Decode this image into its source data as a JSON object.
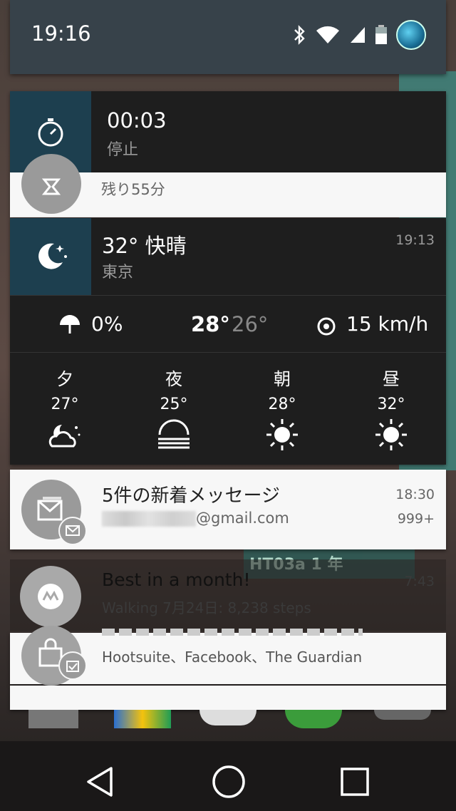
{
  "status_bar": {
    "time": "19:16"
  },
  "stopwatch": {
    "elapsed": "00:03",
    "state": "停止"
  },
  "timer_card": {
    "remaining": "残り55分"
  },
  "weather": {
    "temp_condition": "32° 快晴",
    "city": "東京",
    "updated": "19:13",
    "precip": "0%",
    "high": "28°",
    "low": "26°",
    "wind": "15 km/h",
    "forecast": [
      {
        "label": "夕",
        "temp": "27°",
        "icon": "night-partly-cloudy-icon"
      },
      {
        "label": "夜",
        "temp": "25°",
        "icon": "haze-icon"
      },
      {
        "label": "朝",
        "temp": "28°",
        "icon": "sun-icon"
      },
      {
        "label": "昼",
        "temp": "32°",
        "icon": "sun-icon"
      }
    ]
  },
  "gmail": {
    "title": "5件の新着メッセージ",
    "account": "@gmail.com",
    "time": "18:30",
    "count": "999+"
  },
  "fit": {
    "title": "Best in a month!",
    "detail": "Walking 7月24日: 8,238 steps",
    "time": "7:43"
  },
  "bg_widget": {
    "text": "HT03a 1 年"
  },
  "updates": {
    "apps": "Hootsuite、Facebook、The Guardian"
  },
  "colors": {
    "accent": "#1d3f4f",
    "status_bar": "#37424a"
  }
}
